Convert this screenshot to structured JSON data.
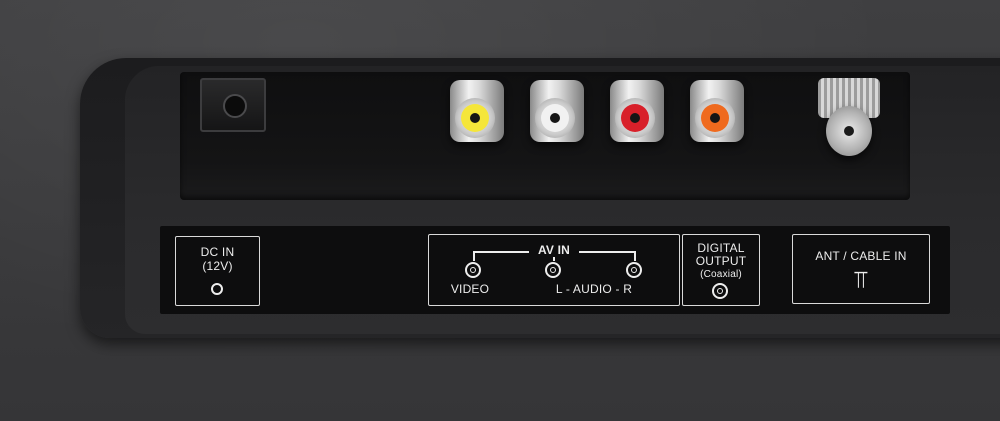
{
  "scene": {
    "description_colors": {
      "background": "#3b3b3d",
      "panel": "#1c1c1e",
      "label_panel": "#0d0d0e",
      "label_text": "#ededed"
    }
  },
  "ports": [
    {
      "name": "dc-in-jack",
      "color": "#151516"
    },
    {
      "name": "video-jack",
      "color": "#f5e63a"
    },
    {
      "name": "audio-left-jack",
      "color": "#f1f1f1"
    },
    {
      "name": "audio-right-jack",
      "color": "#d8202a"
    },
    {
      "name": "digital-coaxial-jack",
      "color": "#ef6a1e"
    },
    {
      "name": "antenna-coax-connector",
      "color": "#c8c8c8"
    }
  ],
  "labels": {
    "dc_in": {
      "line1": "DC IN",
      "line2": "(12V)"
    },
    "av_in": {
      "title": "AV IN",
      "video": "VIDEO",
      "audio": "L - AUDIO - R"
    },
    "digital": {
      "line1": "DIGITAL",
      "line2": "OUTPUT",
      "line3": "(Coaxial)"
    },
    "ant": {
      "title": "ANT / CABLE IN",
      "symbol": "⫪"
    }
  }
}
